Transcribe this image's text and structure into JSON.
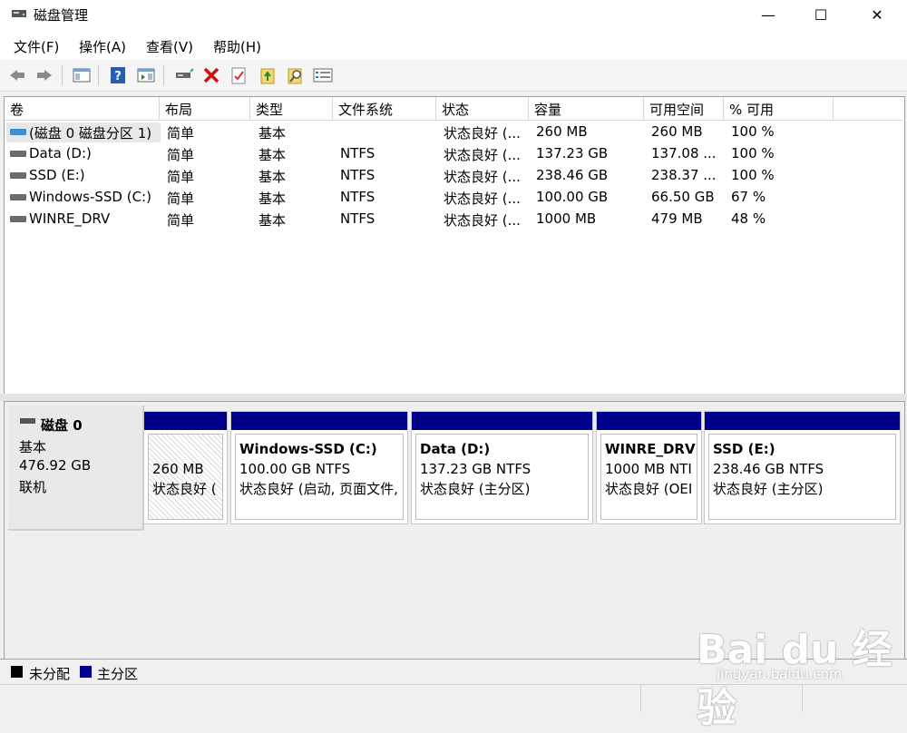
{
  "window": {
    "title": "磁盘管理",
    "controls": {
      "minimize": "—",
      "maximize": "☐",
      "close": "✕"
    }
  },
  "menu": [
    {
      "label": "文件(F)"
    },
    {
      "label": "操作(A)"
    },
    {
      "label": "查看(V)"
    },
    {
      "label": "帮助(H)"
    }
  ],
  "toolbar": {
    "icons": [
      "back-icon",
      "forward-icon",
      "console-tree-icon",
      "help-icon",
      "action-pane-icon",
      "connect-disk-icon",
      "delete-icon",
      "properties-icon",
      "import-icon",
      "find-icon",
      "list-view-icon"
    ]
  },
  "volume_table": {
    "columns": [
      "卷",
      "布局",
      "类型",
      "文件系统",
      "状态",
      "容量",
      "可用空间",
      "% 可用"
    ],
    "rows": [
      {
        "volume": "(磁盘 0 磁盘分区 1)",
        "layout": "简单",
        "type": "基本",
        "fs": "",
        "status": "状态良好 (...",
        "capacity": "260 MB",
        "free": "260 MB",
        "pct": "100 %",
        "selected": true,
        "icon_color": "blue"
      },
      {
        "volume": "Data (D:)",
        "layout": "简单",
        "type": "基本",
        "fs": "NTFS",
        "status": "状态良好 (...",
        "capacity": "137.23 GB",
        "free": "137.08 ...",
        "pct": "100 %",
        "icon_color": "gray"
      },
      {
        "volume": "SSD (E:)",
        "layout": "简单",
        "type": "基本",
        "fs": "NTFS",
        "status": "状态良好 (...",
        "capacity": "238.46 GB",
        "free": "238.37 ...",
        "pct": "100 %",
        "icon_color": "gray"
      },
      {
        "volume": "Windows-SSD (C:)",
        "layout": "简单",
        "type": "基本",
        "fs": "NTFS",
        "status": "状态良好 (...",
        "capacity": "100.00 GB",
        "free": "66.50 GB",
        "pct": "67 %",
        "icon_color": "gray"
      },
      {
        "volume": "WINRE_DRV",
        "layout": "简单",
        "type": "基本",
        "fs": "NTFS",
        "status": "状态良好 (...",
        "capacity": "1000 MB",
        "free": "479 MB",
        "pct": "48 %",
        "icon_color": "gray"
      }
    ]
  },
  "disk": {
    "name": "磁盘 0",
    "type": "基本",
    "size": "476.92 GB",
    "state": "联机",
    "partitions": [
      {
        "name": "",
        "size": "260 MB",
        "status": "状态良好 ("
      },
      {
        "name": "Windows-SSD  (C:)",
        "size": "100.00 GB NTFS",
        "status": "状态良好 (启动, 页面文件,"
      },
      {
        "name": "Data  (D:)",
        "size": "137.23 GB NTFS",
        "status": "状态良好 (主分区)"
      },
      {
        "name": "WINRE_DRV",
        "size": "1000 MB NTI",
        "status": "状态良好 (OEI"
      },
      {
        "name": "SSD  (E:)",
        "size": "238.46 GB NTFS",
        "status": "状态良好 (主分区)"
      }
    ]
  },
  "legend": [
    {
      "label": "未分配",
      "color": "#000000"
    },
    {
      "label": "主分区",
      "color": "#00008b"
    }
  ],
  "watermark": {
    "brand": "Bai du 经验",
    "url": "jingyan.baidu.com"
  },
  "colors": {
    "primary_partition": "#00008b",
    "selected_row": "#e8e8e8",
    "system_drive_icon": "#3b8fd6"
  }
}
